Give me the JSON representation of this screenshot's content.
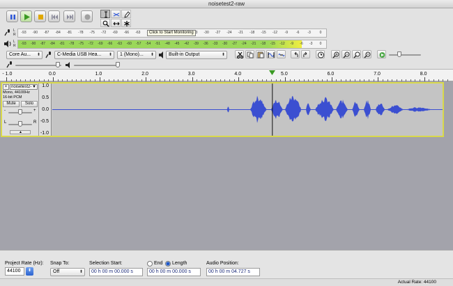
{
  "window": {
    "title": "noisetest2-raw"
  },
  "transport": {
    "buttons": [
      {
        "name": "pause-button",
        "icon": "pause-icon"
      },
      {
        "name": "play-button",
        "icon": "play-icon"
      },
      {
        "name": "stop-button",
        "icon": "stop-icon"
      },
      {
        "name": "skip-start-button",
        "icon": "skip-start-icon"
      },
      {
        "name": "skip-end-button",
        "icon": "skip-end-icon"
      },
      {
        "name": "record-button",
        "icon": "record-icon"
      }
    ]
  },
  "tools": [
    "selection-tool",
    "envelope-tool",
    "draw-tool",
    "zoom-tool",
    "timeshift-tool",
    "multi-tool"
  ],
  "meters": {
    "record_scale": [
      "-93",
      "-90",
      "-87",
      "-84",
      "-81",
      "-78",
      "-75",
      "-72",
      "-69",
      "-66",
      "-63",
      "-60",
      "-57",
      "-39",
      "-36",
      "-33",
      "-30",
      "-27",
      "-24",
      "-21",
      "-18",
      "-15",
      "-12",
      "-9",
      "-6",
      "-3",
      "0"
    ],
    "record_tooltip": "Click to Start Monitoring",
    "play_scale": [
      "-93",
      "-90",
      "-87",
      "-84",
      "-81",
      "-78",
      "-75",
      "-72",
      "-69",
      "-66",
      "-63",
      "-60",
      "-57",
      "-54",
      "-51",
      "-48",
      "-45",
      "-42",
      "-39",
      "-36",
      "-33",
      "-30",
      "-27",
      "-24",
      "-21",
      "-18",
      "-15",
      "-12",
      "-9",
      "-6",
      "-3",
      "0"
    ],
    "lr_left": "L",
    "lr_right": "R",
    "play_level_db": -6,
    "colors": {
      "green": "#9bd85a",
      "yellow": "#f0ee40"
    }
  },
  "devices": {
    "host": "Core Au...",
    "input_device": "C-Media USB Hea...",
    "channels": "1 (Mono)...",
    "output_device": "Built-in Output"
  },
  "ruler": {
    "labels": [
      "- 1.0",
      "0.0",
      "1.0",
      "2.0",
      "3.0",
      "4.0",
      "5.0",
      "6.0",
      "7.0",
      "8.0"
    ],
    "playhead_seconds": 4.727
  },
  "track": {
    "name": "noisetest2-",
    "info": [
      "Mono, 44100Hz",
      "16-bit PCM"
    ],
    "mute_label": "Mute",
    "solo_label": "Solo",
    "gain_minus": "-",
    "gain_plus": "+",
    "pan_left": "L",
    "pan_right": "R",
    "scale": [
      "1.0",
      "0.5",
      "0.0",
      "-0.5",
      "-1.0"
    ],
    "wave_color": "#3b4fd1"
  },
  "selection": {
    "project_rate_label": "Project Rate (Hz):",
    "project_rate": "44100",
    "snap_label": "Snap To:",
    "snap_value": "Off",
    "sel_start_label": "Selection Start:",
    "sel_start": "00 h 00 m 00.000 s",
    "end_label": "End",
    "length_label": "Length",
    "length_value": "00 h 00 m 00.000 s",
    "audio_pos_label": "Audio Position:",
    "audio_pos": "00 h 00 m 04.727 s",
    "length_selected": true
  },
  "status": {
    "actual_rate": "Actual Rate: 44100"
  }
}
